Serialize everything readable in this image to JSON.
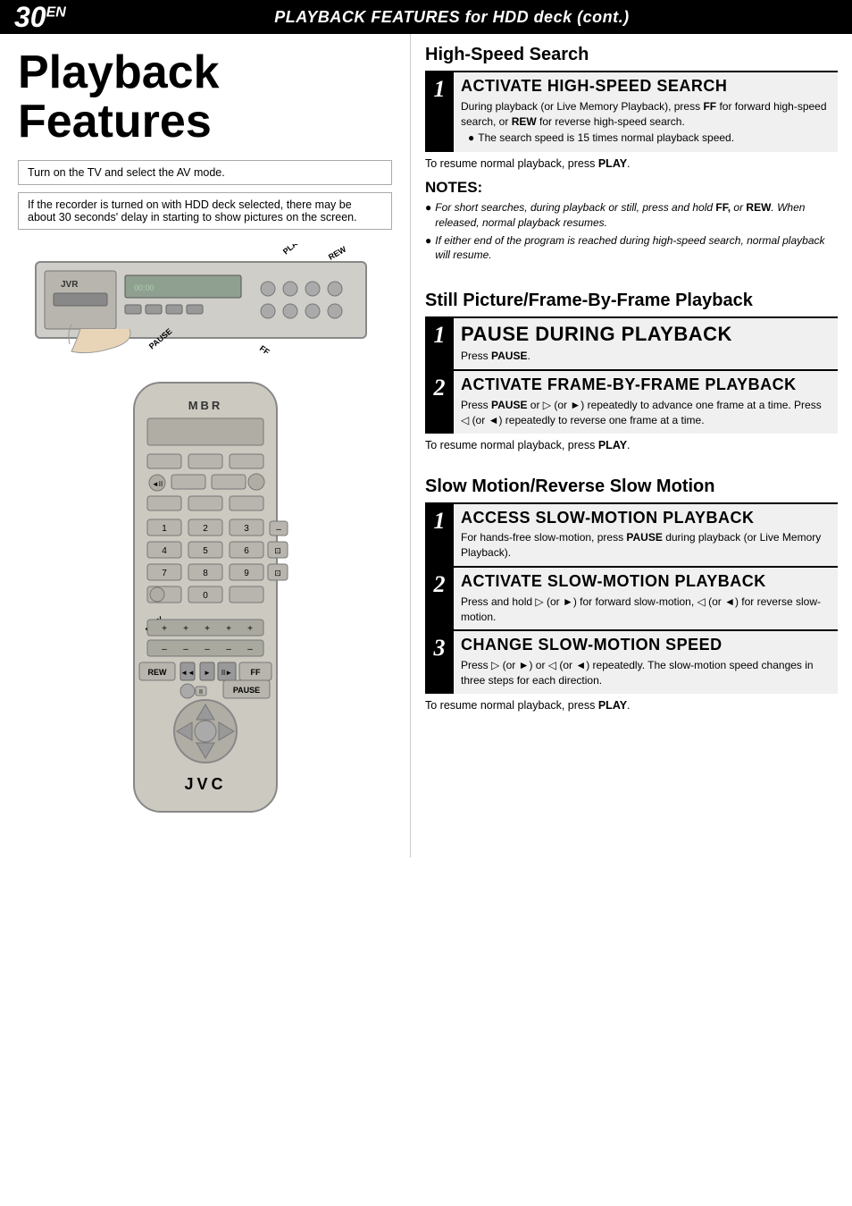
{
  "header": {
    "page_number": "30",
    "page_number_sup": "EN",
    "title": "PLAYBACK FEATURES for HDD deck (cont.)"
  },
  "left": {
    "section_title_line1": "Playback",
    "section_title_line2": "Features",
    "info_box1": "Turn on the TV and select the AV mode.",
    "info_box2": "If the recorder is turned on with HDD deck selected, there may be about 30 seconds' delay in starting to show pictures on the screen."
  },
  "right": {
    "high_speed_search": {
      "heading": "High-Speed Search",
      "step1": {
        "number": "1",
        "title": "ACTIVATE HIGH-SPEED SEARCH",
        "desc": "During playback (or Live Memory Playback), press FF for forward high-speed search, or REW for reverse high-speed search.",
        "desc_bold": [
          "FF",
          "REW"
        ],
        "bullet": "The search speed is 15 times normal playback speed."
      },
      "resume": "To resume normal playback, press PLAY."
    },
    "notes": {
      "heading": "NOTES:",
      "items": [
        "For short searches, during playback or still, press and hold FF, or REW. When released, normal playback resumes.",
        "If either end of the program is reached during high-speed search, normal playback will resume."
      ]
    },
    "still_picture": {
      "heading": "Still Picture/Frame-By-Frame Playback",
      "step1": {
        "number": "1",
        "title": "PAUSE DURING PLAYBACK",
        "desc": "Press PAUSE."
      },
      "step2": {
        "number": "2",
        "title": "ACTIVATE FRAME-BY-FRAME PLAYBACK",
        "desc": "Press PAUSE or ▷ (or ►) repeatedly to advance one frame at a time. Press ◁ (or ◄) repeatedly to reverse one frame at a time."
      },
      "resume": "To resume normal playback, press PLAY."
    },
    "slow_motion": {
      "heading": "Slow Motion/Reverse Slow Motion",
      "step1": {
        "number": "1",
        "title": "ACCESS SLOW-MOTION PLAYBACK",
        "desc": "For hands-free slow-motion, press PAUSE during playback (or Live Memory Playback)."
      },
      "step2": {
        "number": "2",
        "title": "ACTIVATE SLOW-MOTION PLAYBACK",
        "desc": "Press and hold ▷ (or ►) for forward slow-motion, ◁ (or ◄) for reverse slow-motion."
      },
      "step3": {
        "number": "3",
        "title": "CHANGE SLOW-MOTION SPEED",
        "desc": "Press ▷ (or ►) or ◁ (or ◄) repeatedly. The slow-motion speed changes in three steps for each direction."
      },
      "resume": "To resume normal playback, press PLAY."
    }
  }
}
